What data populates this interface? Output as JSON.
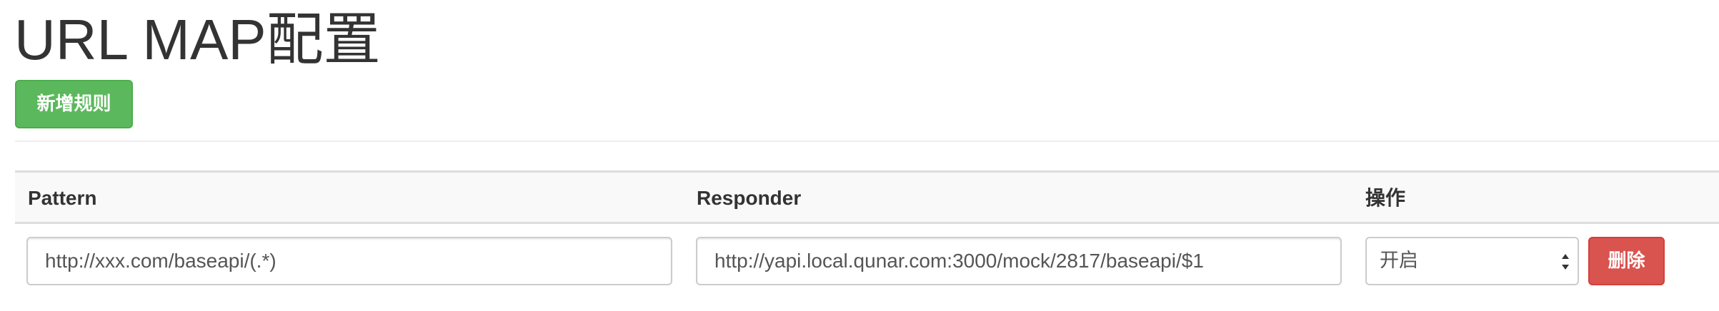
{
  "page": {
    "title": "URL MAP配置"
  },
  "toolbar": {
    "add_rule_label": "新增规则"
  },
  "table": {
    "headers": {
      "pattern": "Pattern",
      "responder": "Responder",
      "operation": "操作"
    },
    "rows": [
      {
        "pattern": "http://xxx.com/baseapi/(.*)",
        "responder": "http://yapi.local.qunar.com:3000/mock/2817/baseapi/$1",
        "status": "开启",
        "delete_label": "删除"
      }
    ]
  },
  "colors": {
    "success": "#5cb85c",
    "danger": "#d9534f",
    "text": "#333333",
    "header_bg": "#f9f9f9"
  }
}
